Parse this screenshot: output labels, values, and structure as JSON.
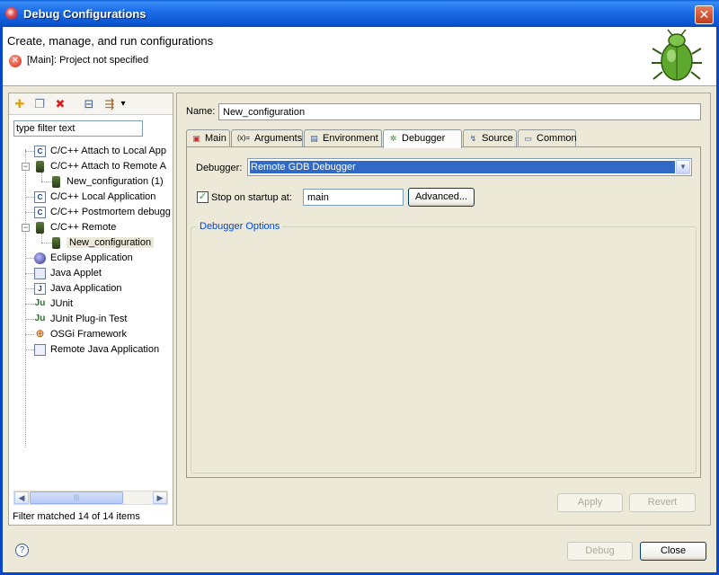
{
  "window": {
    "title": "Debug Configurations",
    "close_glyph": "✕"
  },
  "header": {
    "heading": "Create, manage, and run configurations",
    "message": "[Main]: Project not specified",
    "error_glyph": "✕"
  },
  "left": {
    "toolbar": {
      "new_glyph": "✚",
      "duplicate_glyph": "❐",
      "delete_glyph": "✖",
      "collapse_glyph": "⊟",
      "filter_glyph": "⇶",
      "menu_glyph": "▾"
    },
    "filter_value": "type filter text",
    "tree": [
      {
        "label": "C/C++ Attach to Local App",
        "icon": "C"
      },
      {
        "label": "C/C++ Attach to Remote A",
        "icon": ""
      },
      {
        "label": "New_configuration (1)",
        "icon": ""
      },
      {
        "label": "C/C++ Local Application",
        "icon": "C"
      },
      {
        "label": "C/C++ Postmortem debugg",
        "icon": "C"
      },
      {
        "label": "C/C++ Remote",
        "icon": ""
      },
      {
        "label": "New_configuration",
        "icon": ""
      },
      {
        "label": "Eclipse Application",
        "icon": ""
      },
      {
        "label": "Java Applet",
        "icon": ""
      },
      {
        "label": "Java Application",
        "icon": "J"
      },
      {
        "label": "JUnit",
        "icon": "Ju"
      },
      {
        "label": "JUnit Plug-in Test",
        "icon": "Ju"
      },
      {
        "label": "OSGi Framework",
        "icon": "⊕"
      },
      {
        "label": "Remote Java Application",
        "icon": ""
      }
    ],
    "expander_minus": "−",
    "scroll_left": "◀",
    "scroll_right": "▶",
    "scroll_grip": "|||",
    "filter_status": "Filter matched 14 of 14 items"
  },
  "right": {
    "name_label": "Name:",
    "name_value": "New_configuration",
    "tabs": [
      {
        "label": "Main",
        "icon": "▣"
      },
      {
        "label": "Arguments",
        "icon": "(x)="
      },
      {
        "label": "Environment",
        "icon": "▤"
      },
      {
        "label": "Debugger",
        "icon": "✲"
      },
      {
        "label": "Source",
        "icon": "↯"
      },
      {
        "label": "Common",
        "icon": "▭"
      }
    ],
    "debugger_label": "Debugger:",
    "debugger_value": "Remote GDB Debugger",
    "dropdown_glyph": "▼",
    "stop_on_startup_label": "Stop on startup at:",
    "stop_on_startup_checked_glyph": "✓",
    "stop_on_startup_value": "main",
    "advanced_button": "Advanced...",
    "debugger_options_title": "Debugger Options",
    "apply_button": "Apply",
    "revert_button": "Revert"
  },
  "footer": {
    "help_glyph": "?",
    "debug_button": "Debug",
    "close_button": "Close"
  },
  "colors": {
    "selection": "#316ac5",
    "group_title": "#0046d5",
    "titlebar": "#0a55d0"
  }
}
